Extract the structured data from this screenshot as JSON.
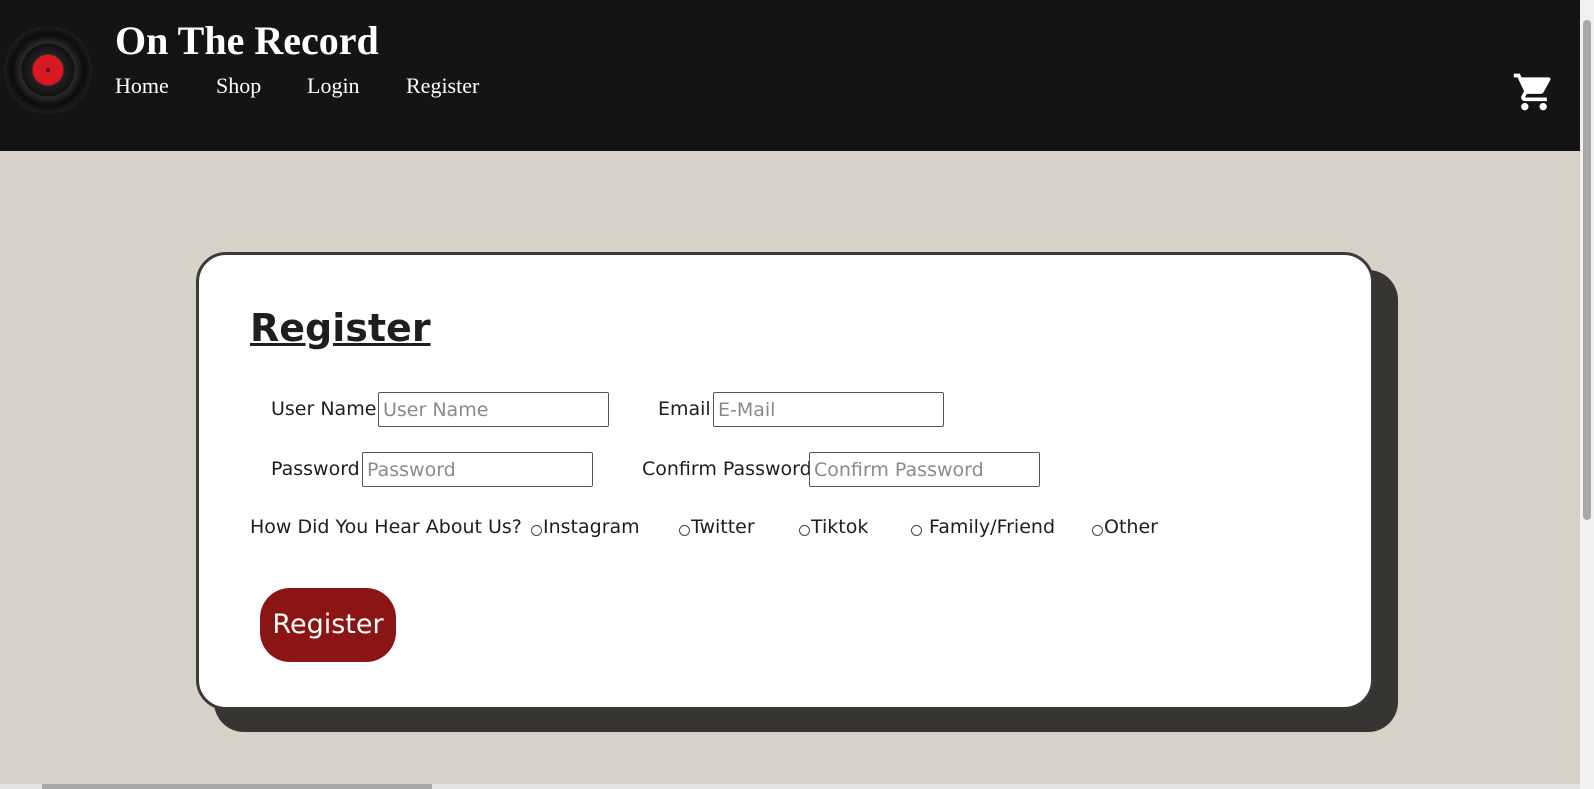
{
  "site": {
    "title": "On The Record"
  },
  "nav": {
    "items": [
      "Home",
      "Shop",
      "Login",
      "Register"
    ]
  },
  "form": {
    "heading": "Register",
    "username_label": "User Name:",
    "username_placeholder": "User Name",
    "email_label": "Email:",
    "email_placeholder": "E-Mail",
    "password_label": "Password:",
    "password_placeholder": "Password",
    "confirm_label": "Confirm Password:",
    "confirm_placeholder": "Confirm Password",
    "hear_label": "How Did You Hear About Us?",
    "options": [
      "Instagram",
      "Twitter",
      "Tiktok",
      " Family/Friend",
      "Other"
    ],
    "submit_label": "Register"
  },
  "colors": {
    "header_bg": "#141414",
    "page_bg": "#d6d2c7",
    "button": "#8b1414"
  },
  "icons": {
    "logo": "vinyl-record-icon",
    "cart": "shopping-cart-icon"
  }
}
